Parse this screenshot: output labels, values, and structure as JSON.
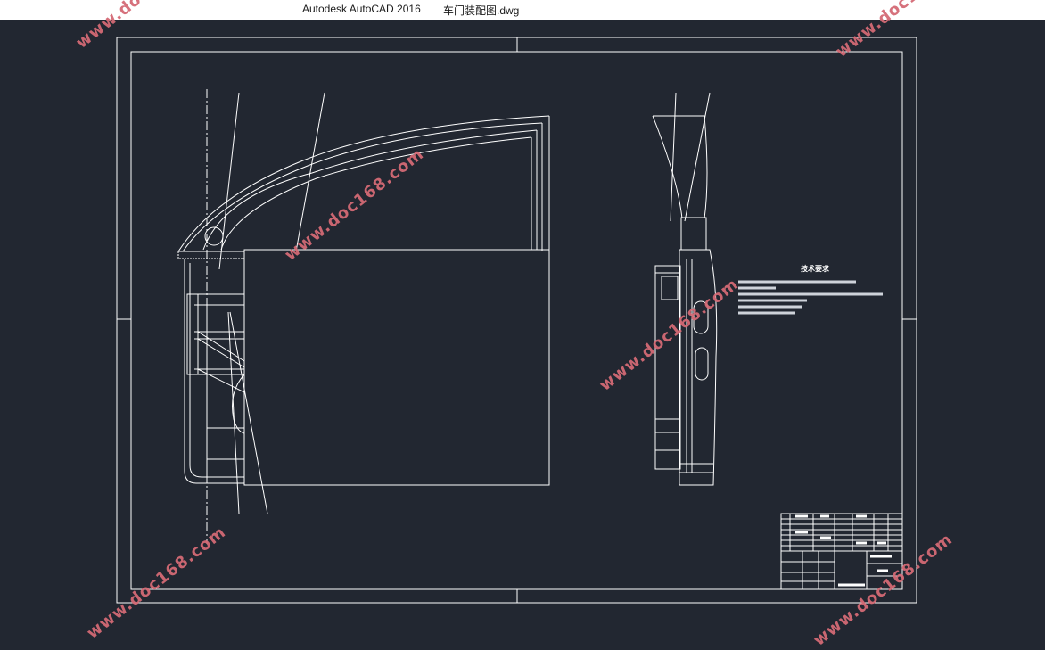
{
  "window": {
    "app_title": "Autodesk AutoCAD 2016",
    "file_title": "车门装配图.dwg"
  },
  "watermark": {
    "text": "www.doc168.com",
    "color": "#d46a75"
  },
  "drawing": {
    "background": "#222731",
    "line_color": "#ffffff",
    "tech_requirements_title": "技术要求"
  }
}
